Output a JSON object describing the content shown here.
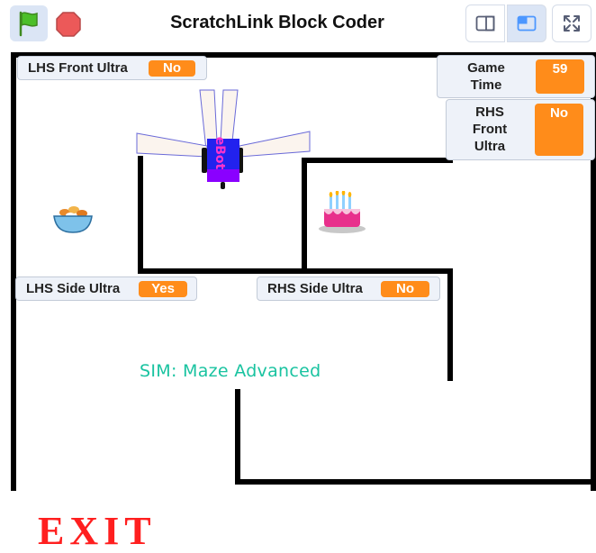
{
  "header": {
    "title": "ScratchLink Block Coder",
    "green_flag_icon": "green-flag-icon",
    "stop_icon": "stop-icon",
    "small_stage_icon": "small-stage-icon",
    "large_stage_icon": "large-stage-icon",
    "fullscreen_icon": "fullscreen-icon"
  },
  "monitors": {
    "lhs_front": {
      "label": "LHS Front Ultra",
      "value": "No"
    },
    "game_time": {
      "label": "Game Time",
      "label_line1": "Game",
      "label_line2": "Time",
      "value": "59"
    },
    "rhs_front": {
      "label": "RHS Front Ultra",
      "label_line1": "RHS",
      "label_line2": "Front",
      "label_line3": "Ultra",
      "value": "No"
    },
    "lhs_side": {
      "label": "LHS Side Ultra",
      "value": "Yes"
    },
    "rhs_side": {
      "label": "RHS Side Ultra",
      "value": "No"
    }
  },
  "stage": {
    "sim_title": "SIM: Maze Advanced",
    "exit_text": "EXIT",
    "robot_text": "eBot",
    "sprites": [
      "robot-sprite",
      "food-bowl-sprite",
      "birthday-cake-sprite"
    ]
  },
  "colors": {
    "accent": "#ff8c1a",
    "monitor_bg": "#eef2f9",
    "sim_title": "#19c3a0",
    "exit": "#ff1f1f",
    "selected_button": "#dbe5f5"
  }
}
